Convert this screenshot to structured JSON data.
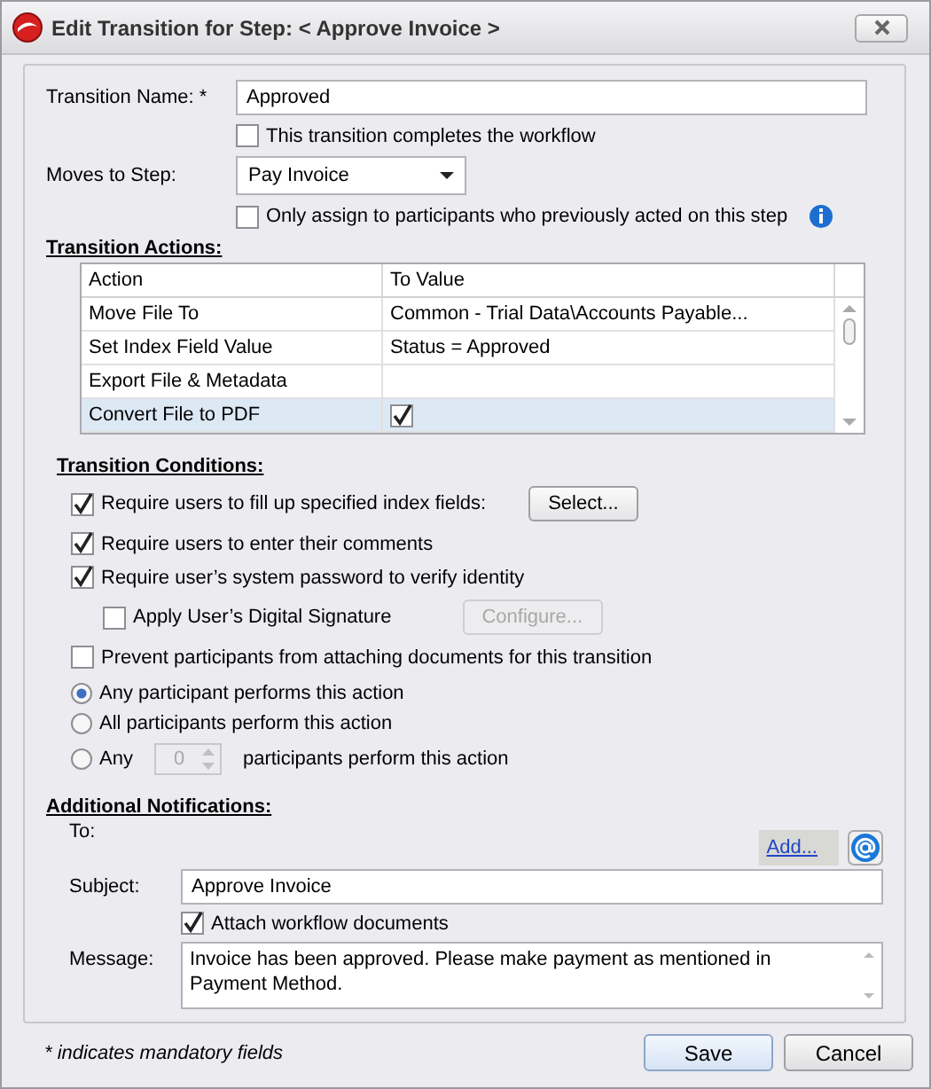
{
  "window": {
    "title": "Edit Transition for Step: < Approve Invoice >"
  },
  "transition_name": {
    "label": "Transition Name: *",
    "value": "Approved"
  },
  "completes_workflow": {
    "label": "This transition completes the workflow",
    "checked": false
  },
  "moves_to_step": {
    "label": "Moves to Step:",
    "value": "Pay Invoice"
  },
  "only_assign": {
    "label": "Only assign to participants who previously acted on this step",
    "checked": false
  },
  "transition_actions": {
    "heading": "Transition Actions:",
    "columns": [
      "Action",
      "To Value"
    ],
    "rows": [
      {
        "kind": "text",
        "action": "Move File To",
        "value": "Common - Trial Data\\Accounts Payable...",
        "selected": false
      },
      {
        "kind": "text",
        "action": "Set Index Field Value",
        "value": "Status = Approved",
        "selected": false
      },
      {
        "kind": "text",
        "action": "Export File & Metadata",
        "selected": false
      },
      {
        "kind": "checkbox",
        "action": "Convert File to PDF",
        "checked": true,
        "selected": true
      }
    ]
  },
  "transition_conditions": {
    "heading": "Transition Conditions:",
    "options": [
      {
        "kind": "checkbox",
        "label": "Require users to fill up specified index fields:",
        "checked": true,
        "indented": false,
        "button": {
          "label": "Select...",
          "disabled": false
        }
      },
      {
        "kind": "checkbox",
        "label": "Require users to enter their comments",
        "checked": true,
        "indented": false
      },
      {
        "kind": "checkbox",
        "label": "Require user’s system password to verify identity",
        "checked": true,
        "indented": false
      },
      {
        "kind": "checkbox",
        "label": "Apply User’s Digital Signature",
        "checked": false,
        "indented": true,
        "button": {
          "label": "Configure...",
          "disabled": true
        }
      },
      {
        "kind": "checkbox",
        "label": "Prevent participants from attaching documents for this transition",
        "checked": false,
        "indented": false
      },
      {
        "kind": "radio",
        "label": "Any participant performs this action",
        "selected": true
      },
      {
        "kind": "radio",
        "label": "All participants perform this action",
        "selected": false
      },
      {
        "kind": "radio",
        "label": "Any",
        "selected": false,
        "spinner": {
          "value": "0",
          "disabled": true
        },
        "suffix": "participants perform this action"
      }
    ]
  },
  "additional_notifications": {
    "heading": "Additional Notifications:",
    "to_label": "To:",
    "add_link": "Add...",
    "subject": {
      "label": "Subject:",
      "value": "Approve Invoice"
    },
    "attach_documents": {
      "label": "Attach workflow documents",
      "checked": true
    },
    "message": {
      "label": "Message:",
      "value": "Invoice has been approved. Please make payment as mentioned in Payment Method."
    }
  },
  "footer": {
    "note": "* indicates mandatory fields",
    "buttons": [
      {
        "label": "Save",
        "default": true
      },
      {
        "label": "Cancel",
        "default": false
      }
    ]
  }
}
